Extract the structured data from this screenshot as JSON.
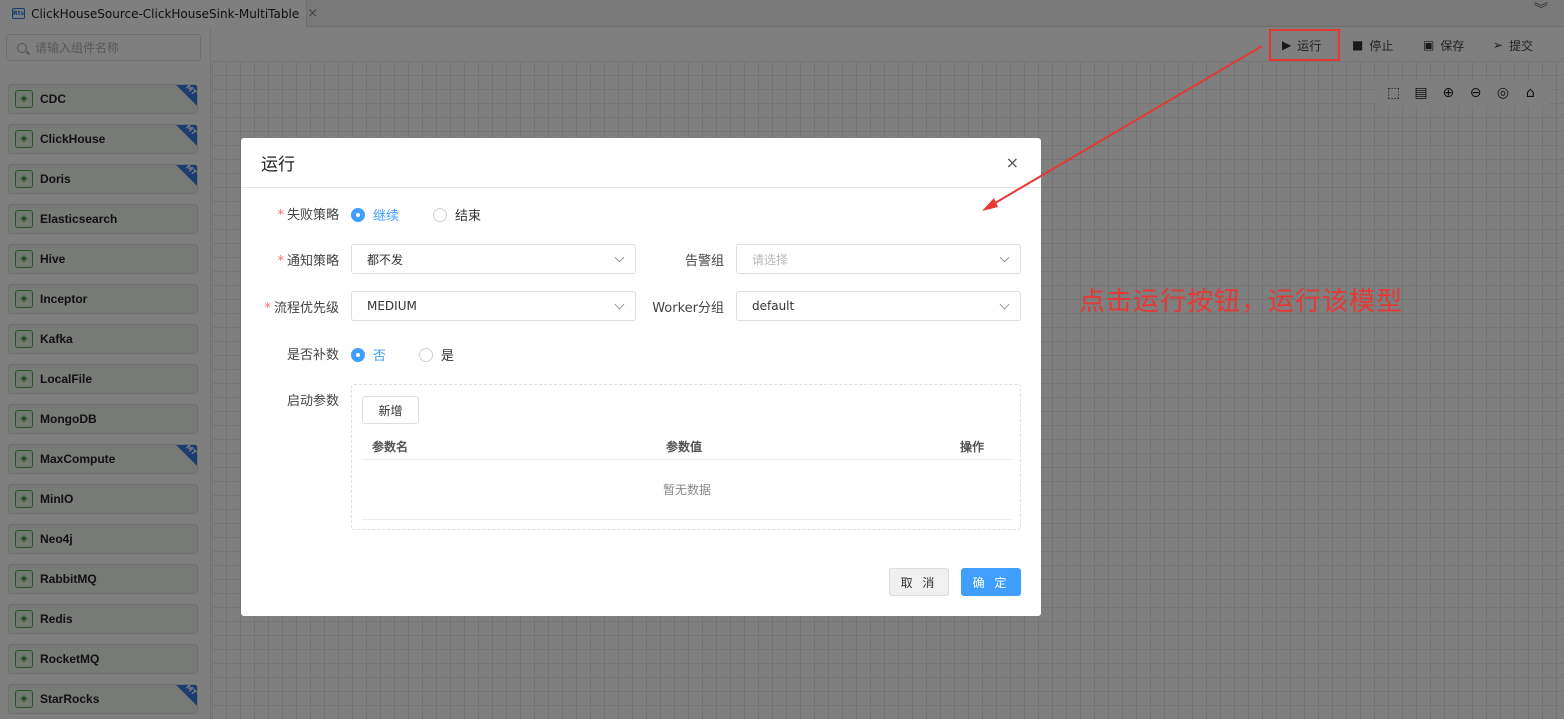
{
  "tab": {
    "title": "ClickHouseSource-ClickHouseSink-MultiTable",
    "close": "×",
    "logo": "Rts"
  },
  "toolbar": {
    "run": "运行",
    "stop": "停止",
    "save": "保存",
    "submit": "提交"
  },
  "sidebar": {
    "search_placeholder": "请输入组件名称",
    "items": [
      {
        "label": "CDC",
        "badge": "MT",
        "icon": "database-icon"
      },
      {
        "label": "ClickHouse",
        "badge": "MT",
        "icon": "clickhouse-icon"
      },
      {
        "label": "Doris",
        "badge": "MT",
        "icon": "doris-icon"
      },
      {
        "label": "Elasticsearch",
        "badge": "",
        "icon": "elasticsearch-icon"
      },
      {
        "label": "Hive",
        "badge": "",
        "icon": "hive-icon"
      },
      {
        "label": "Inceptor",
        "badge": "",
        "icon": "inceptor-icon"
      },
      {
        "label": "Kafka",
        "badge": "",
        "icon": "kafka-icon"
      },
      {
        "label": "LocalFile",
        "badge": "",
        "icon": "folder-icon"
      },
      {
        "label": "MongoDB",
        "badge": "",
        "icon": "mongodb-icon"
      },
      {
        "label": "MaxCompute",
        "badge": "MT",
        "icon": "maxcompute-icon"
      },
      {
        "label": "MinIO",
        "badge": "",
        "icon": "minio-icon"
      },
      {
        "label": "Neo4j",
        "badge": "",
        "icon": "neo4j-icon"
      },
      {
        "label": "RabbitMQ",
        "badge": "",
        "icon": "rabbitmq-icon"
      },
      {
        "label": "Redis",
        "badge": "",
        "icon": "redis-icon"
      },
      {
        "label": "RocketMQ",
        "badge": "",
        "icon": "rocketmq-icon"
      },
      {
        "label": "StarRocks",
        "badge": "MT",
        "icon": "starrocks-icon"
      }
    ]
  },
  "dialog": {
    "title": "运行",
    "close": "×",
    "failure_strategy": {
      "label": "失败策略",
      "options": [
        "继续",
        "结束"
      ],
      "selected": "继续"
    },
    "notify_strategy": {
      "label": "通知策略",
      "value": "都不发"
    },
    "alert_group": {
      "label": "告警组",
      "placeholder": "请选择"
    },
    "priority": {
      "label": "流程优先级",
      "value": "MEDIUM"
    },
    "worker_group": {
      "label": "Worker分组",
      "value": "default"
    },
    "backfill": {
      "label": "是否补数",
      "options": [
        "否",
        "是"
      ],
      "selected": "否"
    },
    "start_params": {
      "label": "启动参数",
      "add_button": "新增",
      "columns": [
        "参数名",
        "参数值",
        "操作"
      ],
      "empty_text": "暂无数据"
    },
    "cancel": "取 消",
    "confirm": "确 定"
  },
  "annotation": {
    "text": "点击运行按钮，运行该模型",
    "color": "#e53935"
  },
  "colors": {
    "primary": "#409eff",
    "required": "#f56c6c",
    "highlight": "#e53935"
  }
}
